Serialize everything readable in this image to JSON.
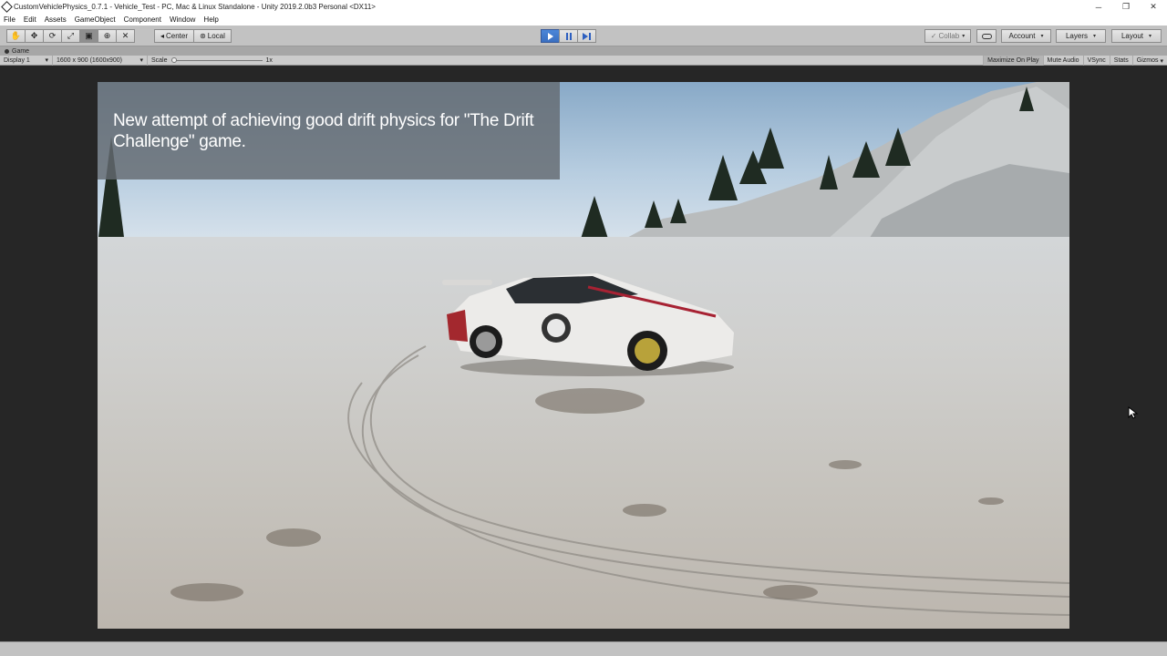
{
  "window": {
    "title": "CustomVehiclePhysics_0.7.1 - Vehicle_Test - PC, Mac & Linux Standalone - Unity 2019.2.0b3 Personal <DX11>",
    "minimize_glyph": "─",
    "restore_glyph": "❐",
    "close_glyph": "✕"
  },
  "menu": {
    "items": [
      "File",
      "Edit",
      "Assets",
      "GameObject",
      "Component",
      "Window",
      "Help"
    ]
  },
  "toolbar": {
    "tools": [
      "hand-tool",
      "move-tool",
      "rotate-tool",
      "scale-tool",
      "rect-tool",
      "transform-tool",
      "custom-tool"
    ],
    "tool_glyphs": [
      "✋",
      "✥",
      "⟳",
      "⤢",
      "▣",
      "⊕",
      "✕"
    ],
    "active_tool": "rect-tool",
    "pivot_label": "Center",
    "space_label": "Local",
    "collab_label": "Collab",
    "account_label": "Account",
    "layers_label": "Layers",
    "layout_label": "Layout"
  },
  "game_tab": {
    "label": "Game"
  },
  "game_bar": {
    "display_label": "Display 1",
    "resolution_label": "1600 x 900 (1600x900)",
    "scale_label": "Scale",
    "scale_value": "1x",
    "maximize_label": "Maximize On Play",
    "mute_label": "Mute Audio",
    "vsync_label": "VSync",
    "stats_label": "Stats",
    "gizmos_label": "Gizmos"
  },
  "game_view": {
    "caption": "New attempt of achieving good drift physics for \"The Drift Challenge\" game."
  },
  "colors": {
    "play_active": "#3a6fc1",
    "toolbar_bg": "#c2c2c2",
    "editor_dark": "#262626",
    "caption_bg": "#646a70"
  }
}
